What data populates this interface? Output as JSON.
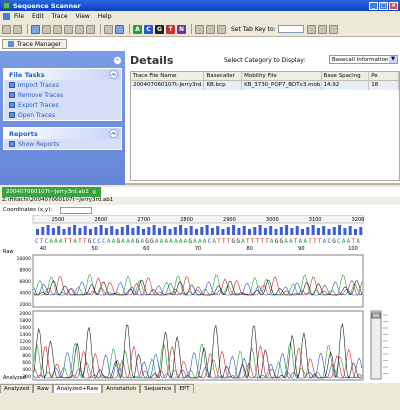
{
  "window": {
    "title": "Sequence Scanner"
  },
  "menu": [
    "File",
    "Edit",
    "Trace",
    "View",
    "Help"
  ],
  "toolbar": {
    "nucleotides": [
      {
        "label": "A",
        "color": "#22A33A"
      },
      {
        "label": "C",
        "color": "#2B54D6"
      },
      {
        "label": "G",
        "color": "#222222"
      },
      {
        "label": "T",
        "color": "#D42A2A"
      },
      {
        "label": "N",
        "color": "#7A2E9E"
      }
    ],
    "tab_key_label": "Set Tab Key to:"
  },
  "trace_manager": {
    "tab_label": "Trace Manager"
  },
  "tasks": {
    "file_tasks": {
      "title": "File Tasks",
      "items": [
        "Import Traces",
        "Remove Traces",
        "Export Traces",
        "Open Traces"
      ]
    },
    "reports": {
      "title": "Reports",
      "items": [
        "Show Reports"
      ]
    }
  },
  "details": {
    "title": "Details",
    "category_label": "Select Category to Display:",
    "category_value": "Basecall Information",
    "columns": [
      "Trace File Name",
      "Basecaller",
      "Mobility File",
      "Base Spacing",
      "Pe"
    ],
    "rows": [
      [
        "200407060107t-Jerry3rd.ab1",
        "KB.bcp",
        "KB_3730_POP7_BDTv3.mob",
        "14.92",
        "18"
      ]
    ]
  },
  "trace_view": {
    "tab_label": "200407060107t~Jerry3rd.ab1",
    "path": "Z:\\Hitachi\\200407060107t~Jerry3rd.ab1",
    "coord_label": "Coordinates (x,y):",
    "scale_ticks": [
      "2500",
      "2600",
      "2700",
      "2800",
      "2900",
      "3000",
      "3100",
      "3200"
    ],
    "sequence": "CT CAAA TTATT  G CCCAAG AAAG AGG AAAAAAAG AAAC ATTT G G ATTTTTAGGAATAATTTAC GCAATA",
    "position_ticks": [
      "40",
      "50",
      "60",
      "70",
      "80",
      "90",
      "100"
    ],
    "raw_label": "Raw",
    "raw_ticks": [
      "10000",
      "8000",
      "6000",
      "4000",
      "2000"
    ],
    "analyzed_label": "Analyzed",
    "analyzed_ticks": [
      "2000",
      "1800",
      "1600",
      "1400",
      "1200",
      "1000",
      "800",
      "600",
      "400",
      "200"
    ]
  },
  "bottom_tabs": [
    "Analyzed",
    "Raw",
    "Analyzed+Raw",
    "Annotation",
    "Sequence",
    "EPT"
  ],
  "active_tab": "Analyzed+Raw"
}
